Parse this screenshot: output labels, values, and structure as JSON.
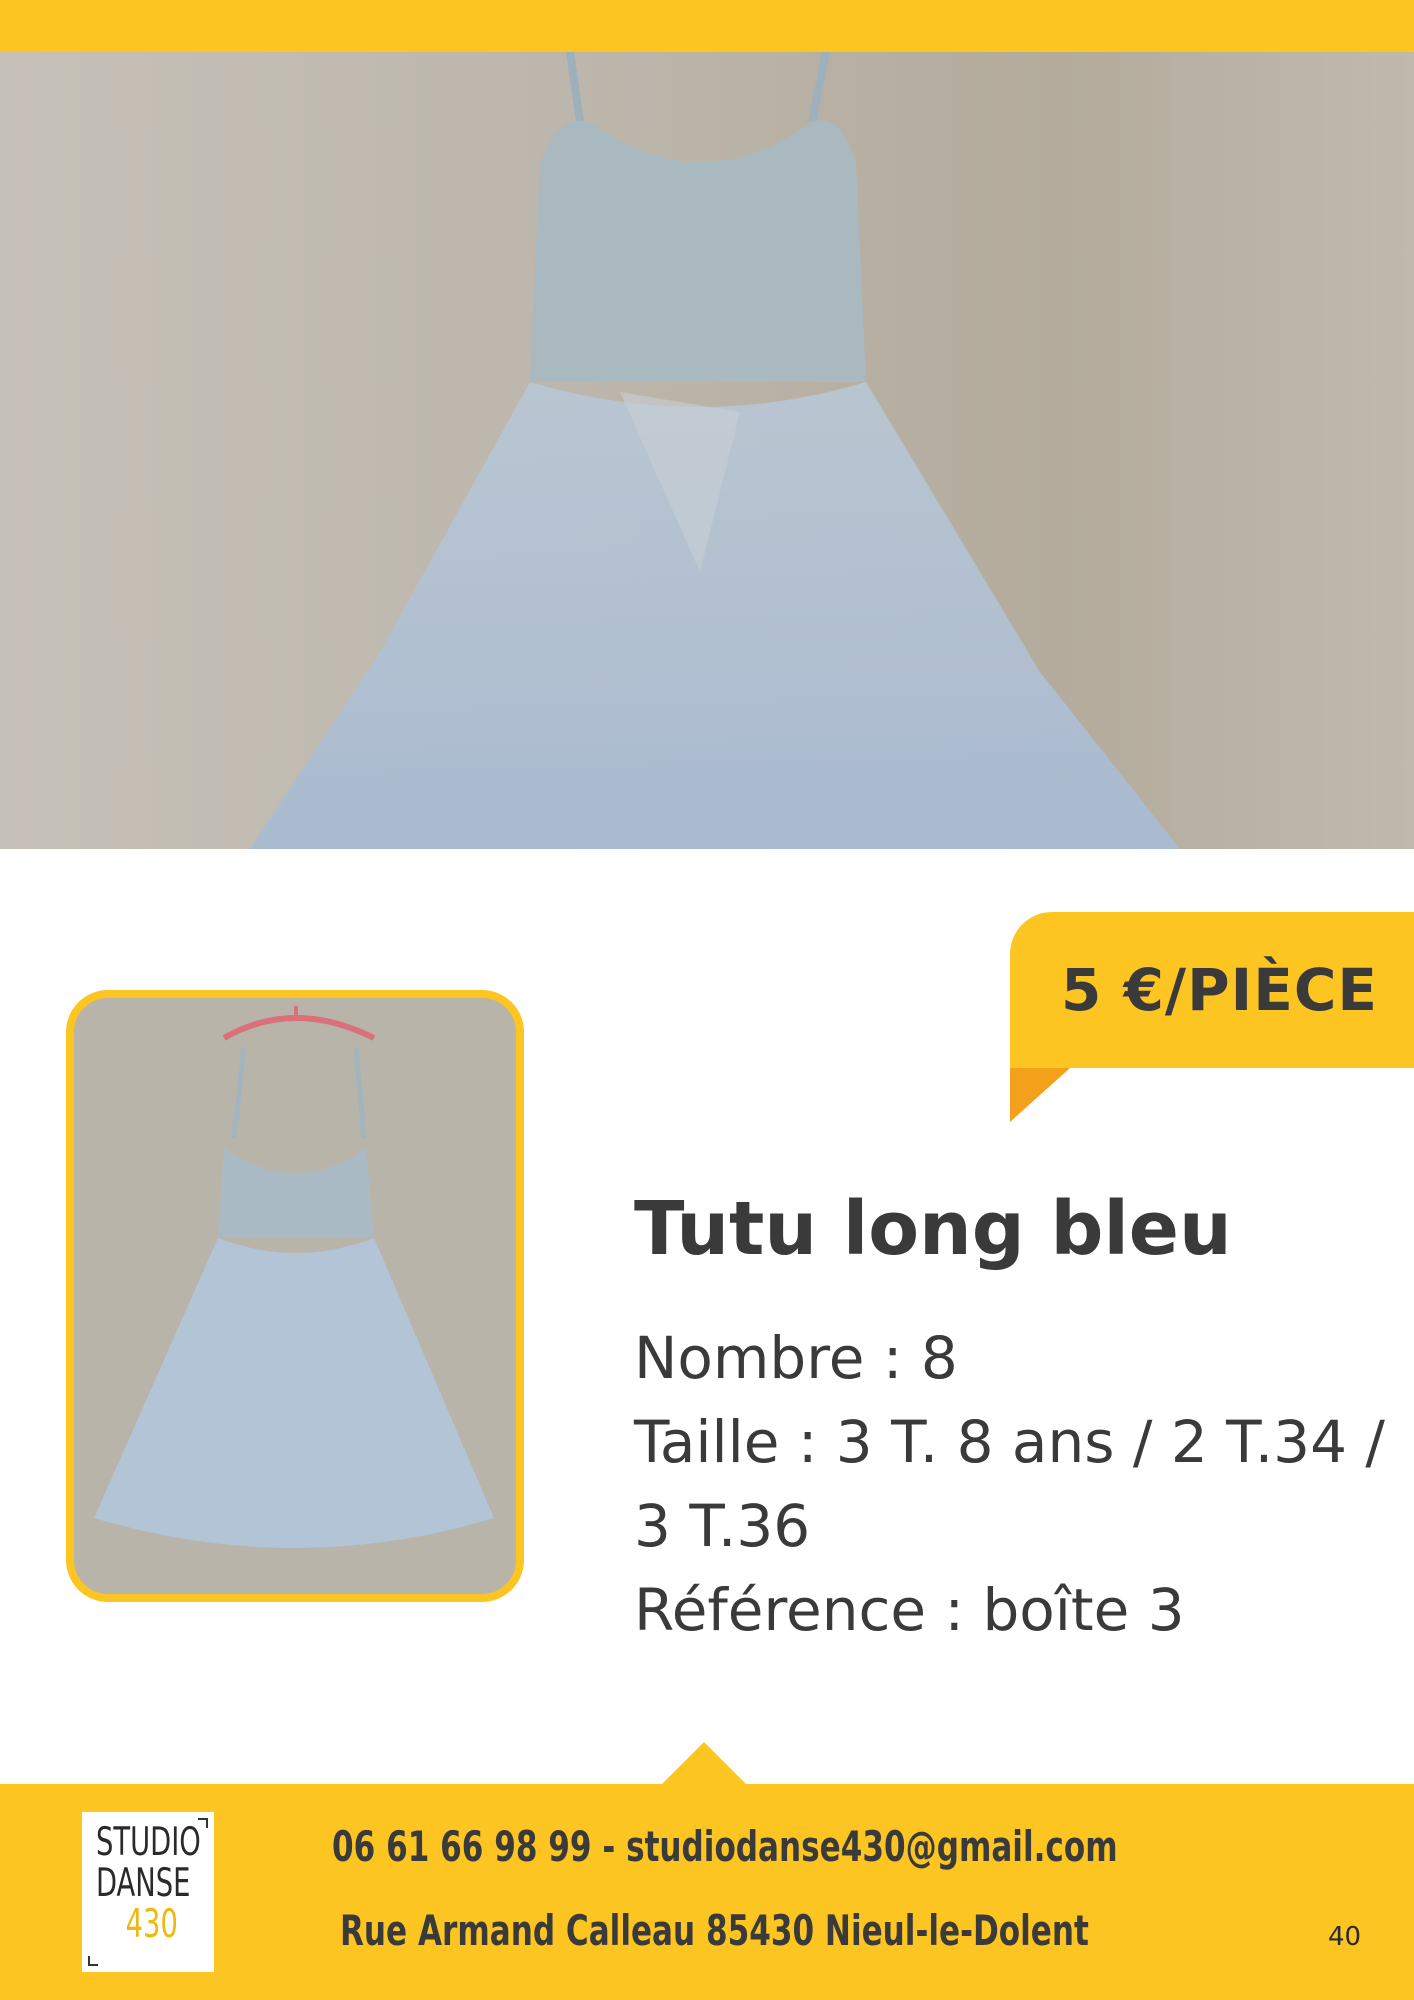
{
  "product": {
    "price": "5 €/PIÈCE",
    "title": "Tutu long bleu",
    "nombre": "Nombre : 8",
    "taille_line1": "Taille : 3 T. 8 ans / 2 T.34 /",
    "taille_line2": "3 T.36",
    "reference": "Référence : boîte 3"
  },
  "footer": {
    "logo_line1": "STUDIO",
    "logo_line2": "DANSE",
    "logo_line3": "430",
    "contact": "06 61 66 98 99 - studiodanse430@gmail.com",
    "address": "Rue Armand Calleau 85430 Nieul-le-Dolent",
    "page_number": "40"
  },
  "colors": {
    "accent": "#fcc521",
    "accent_dark": "#f5a01a",
    "text": "#3a3a3a"
  }
}
